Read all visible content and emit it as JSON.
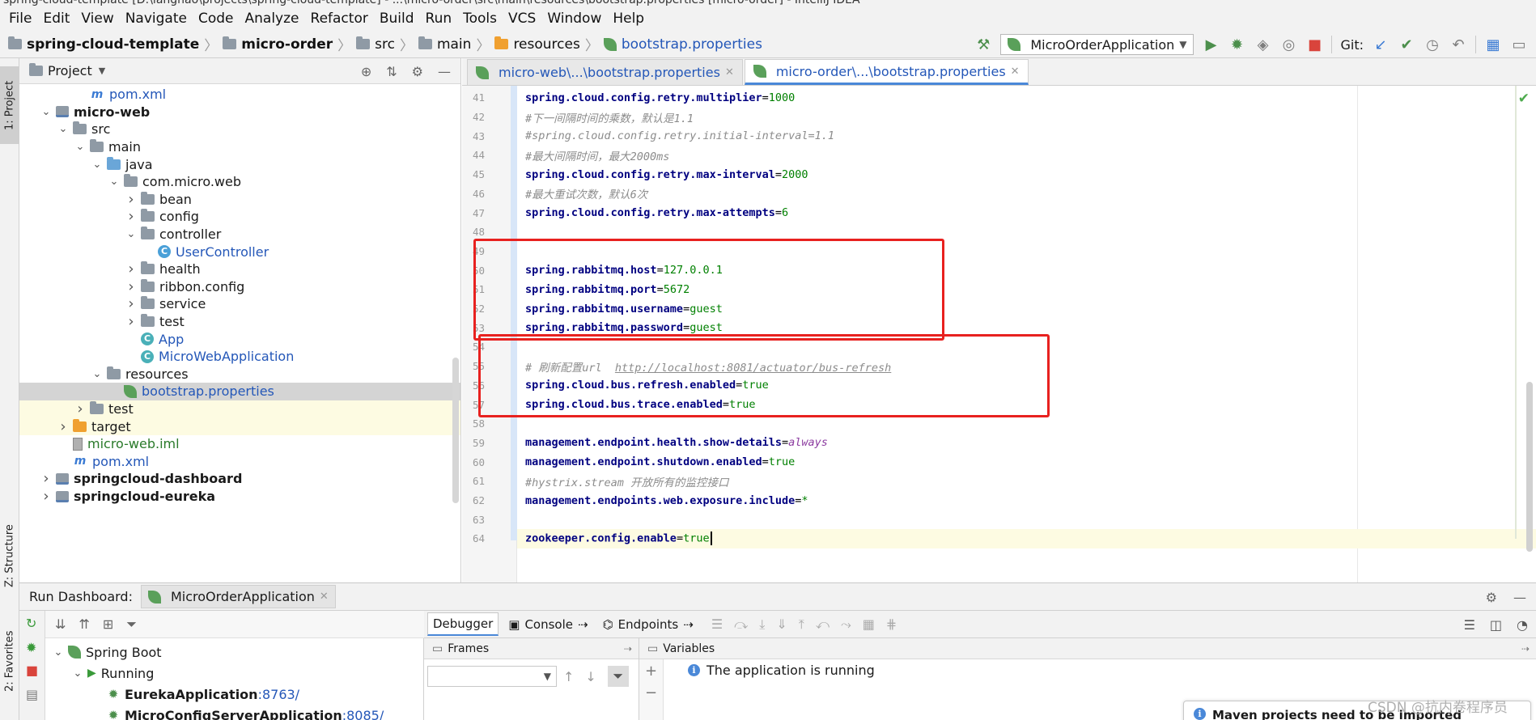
{
  "window": {
    "title": "spring-cloud-template [D:\\langhao\\projects\\spring-cloud-template] - ...\\micro-order\\src\\main\\resources\\bootstrap.properties [micro-order] - IntelliJ IDEA"
  },
  "menu": [
    "File",
    "Edit",
    "View",
    "Navigate",
    "Code",
    "Analyze",
    "Refactor",
    "Build",
    "Run",
    "Tools",
    "VCS",
    "Window",
    "Help"
  ],
  "breadcrumb": [
    "spring-cloud-template",
    "micro-order",
    "src",
    "main",
    "resources",
    "bootstrap.properties"
  ],
  "toolbar": {
    "run_config": "MicroOrderApplication",
    "git_label": "Git:"
  },
  "side_tabs": {
    "project": "1: Project",
    "structure": "Z: Structure",
    "favorites": "2: Favorites"
  },
  "project": {
    "title": "Project",
    "rows": [
      {
        "label": "pom.xml",
        "depth": 3,
        "kind": "maven"
      },
      {
        "label": "micro-web",
        "depth": 1,
        "kind": "module",
        "expanded": true
      },
      {
        "label": "src",
        "depth": 2,
        "kind": "folder",
        "expanded": true
      },
      {
        "label": "main",
        "depth": 3,
        "kind": "folder",
        "expanded": true
      },
      {
        "label": "java",
        "depth": 4,
        "kind": "folder-blue",
        "expanded": true
      },
      {
        "label": "com.micro.web",
        "depth": 5,
        "kind": "package",
        "expanded": true
      },
      {
        "label": "bean",
        "depth": 6,
        "kind": "package",
        "expanded": false
      },
      {
        "label": "config",
        "depth": 6,
        "kind": "package",
        "expanded": false
      },
      {
        "label": "controller",
        "depth": 6,
        "kind": "package",
        "expanded": true
      },
      {
        "label": "UserController",
        "depth": 7,
        "kind": "class"
      },
      {
        "label": "health",
        "depth": 6,
        "kind": "package",
        "expanded": false
      },
      {
        "label": "ribbon.config",
        "depth": 6,
        "kind": "package",
        "expanded": false
      },
      {
        "label": "service",
        "depth": 6,
        "kind": "package",
        "expanded": false
      },
      {
        "label": "test",
        "depth": 6,
        "kind": "package",
        "expanded": false
      },
      {
        "label": "App",
        "depth": 6,
        "kind": "app"
      },
      {
        "label": "MicroWebApplication",
        "depth": 6,
        "kind": "app"
      },
      {
        "label": "resources",
        "depth": 4,
        "kind": "folder",
        "expanded": true
      },
      {
        "label": "bootstrap.properties",
        "depth": 5,
        "kind": "properties",
        "selected": true
      },
      {
        "label": "test",
        "depth": 3,
        "kind": "folder",
        "expanded": false
      },
      {
        "label": "target",
        "depth": 2,
        "kind": "folder-orange",
        "expanded": false
      },
      {
        "label": "micro-web.iml",
        "depth": 2,
        "kind": "iml"
      },
      {
        "label": "pom.xml",
        "depth": 2,
        "kind": "maven"
      },
      {
        "label": "springcloud-dashboard",
        "depth": 1,
        "kind": "module",
        "expanded": false
      },
      {
        "label": "springcloud-eureka",
        "depth": 1,
        "kind": "module",
        "expanded": false
      }
    ]
  },
  "editor": {
    "tabs": [
      {
        "label": "micro-web\\...\\bootstrap.properties",
        "active": false
      },
      {
        "label": "micro-order\\...\\bootstrap.properties",
        "active": true
      }
    ],
    "lines": [
      {
        "n": "41",
        "type": "kv",
        "key": "spring.cloud.config.retry.multiplier",
        "val": "1000"
      },
      {
        "n": "42",
        "type": "comment",
        "text": "#下一间隔时间的乘数，默认是1.1"
      },
      {
        "n": "43",
        "type": "comment",
        "text": "#spring.cloud.config.retry.initial-interval=1.1"
      },
      {
        "n": "44",
        "type": "comment",
        "text": "#最大间隔时间，最大2000ms"
      },
      {
        "n": "45",
        "type": "kv",
        "key": "spring.cloud.config.retry.max-interval",
        "val": "2000"
      },
      {
        "n": "46",
        "type": "comment",
        "text": "#最大重试次数，默认6次"
      },
      {
        "n": "47",
        "type": "kv",
        "key": "spring.cloud.config.retry.max-attempts",
        "val": "6"
      },
      {
        "n": "48",
        "type": "blank"
      },
      {
        "n": "49",
        "type": "blank"
      },
      {
        "n": "50",
        "type": "kv",
        "key": "spring.rabbitmq.host",
        "val": "127.0.0.1"
      },
      {
        "n": "51",
        "type": "kv",
        "key": "spring.rabbitmq.port",
        "val": "5672"
      },
      {
        "n": "52",
        "type": "kv",
        "key": "spring.rabbitmq.username",
        "val": "guest"
      },
      {
        "n": "53",
        "type": "kv",
        "key": "spring.rabbitmq.password",
        "val": "guest"
      },
      {
        "n": "54",
        "type": "blank"
      },
      {
        "n": "55",
        "type": "comment-url",
        "text": "# 刷新配置url  ",
        "url": "http://localhost:8081/actuator/bus-refresh"
      },
      {
        "n": "56",
        "type": "kv",
        "key": "spring.cloud.bus.refresh.enabled",
        "val": "true"
      },
      {
        "n": "57",
        "type": "kv",
        "key": "spring.cloud.bus.trace.enabled",
        "val": "true"
      },
      {
        "n": "58",
        "type": "blank"
      },
      {
        "n": "59",
        "type": "kv-purple",
        "key": "management.endpoint.health.show-details",
        "val": "always"
      },
      {
        "n": "60",
        "type": "kv",
        "key": "management.endpoint.shutdown.enabled",
        "val": "true"
      },
      {
        "n": "61",
        "type": "comment",
        "text": "#hystrix.stream  开放所有的监控接口"
      },
      {
        "n": "62",
        "type": "kv",
        "key": "management.endpoints.web.exposure.include",
        "val": "*"
      },
      {
        "n": "63",
        "type": "blank"
      },
      {
        "n": "64",
        "type": "kv",
        "key": "zookeeper.config.enable",
        "val": "true",
        "current": true
      }
    ]
  },
  "run_dashboard": {
    "title": "Run Dashboard:",
    "tab": "MicroOrderApplication",
    "tree": [
      {
        "label": "Spring Boot",
        "depth": 0,
        "kind": "springboot"
      },
      {
        "label": "Running",
        "depth": 1,
        "kind": "running"
      },
      {
        "label": "EurekaApplication",
        "port": ":8763/",
        "depth": 2,
        "kind": "app"
      },
      {
        "label": "MicroConfigServerApplication",
        "port": ":8085/",
        "depth": 2,
        "kind": "app"
      }
    ]
  },
  "debugger": {
    "tabs": [
      "Debugger",
      "Console",
      "Endpoints"
    ],
    "frames_title": "Frames",
    "variables_title": "Variables",
    "status": "The application is running"
  },
  "notification": {
    "text": "Maven projects need to be imported"
  },
  "watermark": "CSDN @抗内卷程序员",
  "colors": {
    "highlight_box": "#e8211f",
    "key": "#000080",
    "value": "#008000",
    "comment": "#8c8c8c"
  }
}
